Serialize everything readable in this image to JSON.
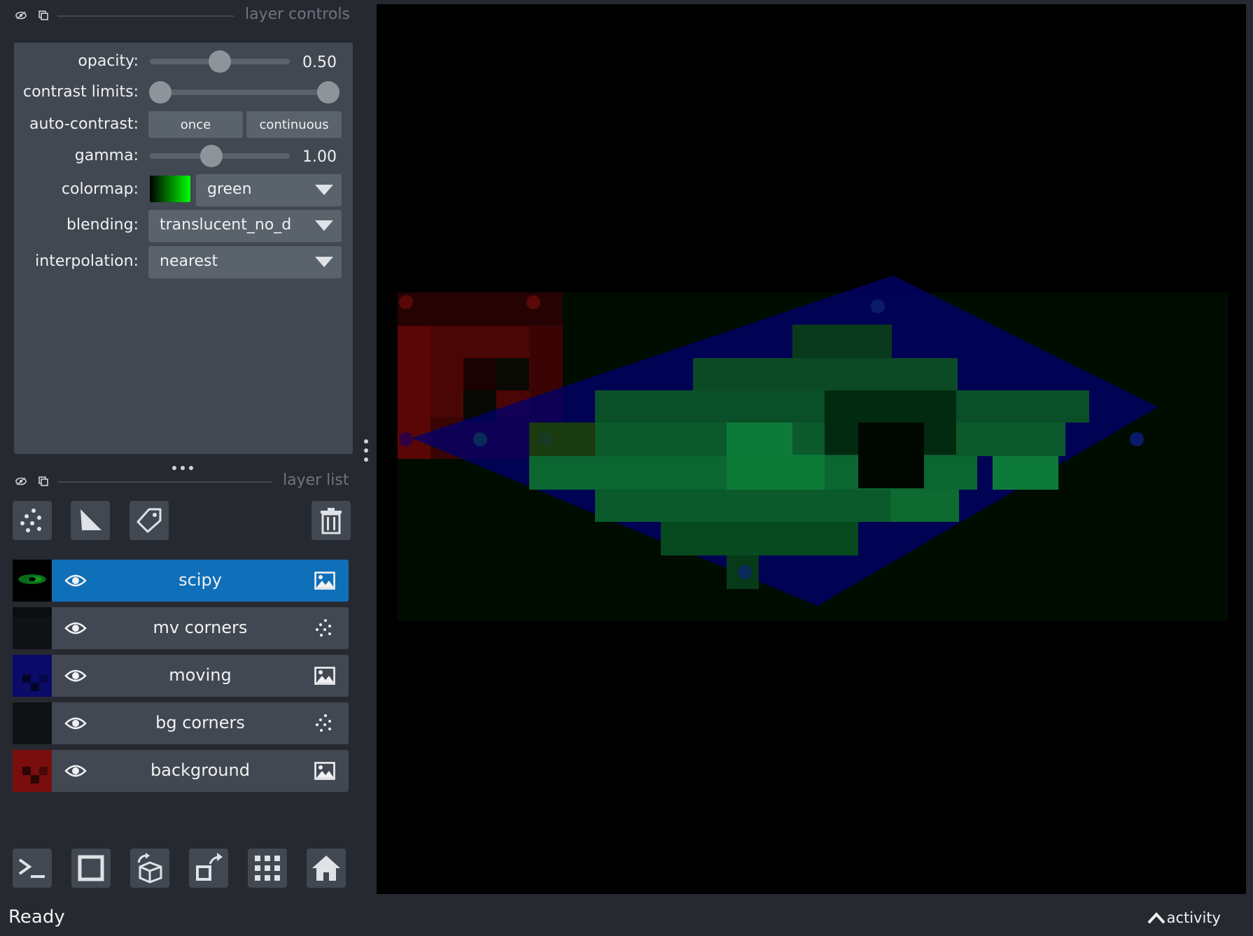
{
  "layer_controls": {
    "title": "layer controls",
    "opacity_label": "opacity:",
    "opacity_value": "0.50",
    "opacity_level": 0.5,
    "contrast_label": "contrast limits:",
    "contrast_range": [
      0.0,
      1.0
    ],
    "auto_contrast_label": "auto-contrast:",
    "once_label": "once",
    "continuous_label": "continuous",
    "gamma_label": "gamma:",
    "gamma_value": "1.00",
    "colormap_label": "colormap:",
    "colormap_value": "green",
    "blending_label": "blending:",
    "blending_value": "translucent_no_depth",
    "interpolation_label": "interpolation:",
    "interpolation_value": "nearest"
  },
  "layer_list": {
    "title": "layer list",
    "layers": [
      {
        "name": "scipy",
        "type": "image",
        "selected": true,
        "visible": true
      },
      {
        "name": "mv corners",
        "type": "points",
        "selected": false,
        "visible": true
      },
      {
        "name": "moving",
        "type": "image",
        "selected": false,
        "visible": true
      },
      {
        "name": "bg corners",
        "type": "points",
        "selected": false,
        "visible": true
      },
      {
        "name": "background",
        "type": "image",
        "selected": false,
        "visible": true
      }
    ]
  },
  "toolbar": {
    "new_points_icon": "points-icon",
    "new_shapes_icon": "shapes-icon",
    "new_labels_icon": "labels-tag-icon",
    "delete_icon": "trash-icon"
  },
  "bottom_bar": [
    "console-icon",
    "ndisplay-square-icon",
    "roll-cube-icon",
    "transpose-icon",
    "grid-icon",
    "home-icon"
  ],
  "status": {
    "text": "Ready",
    "activity_label": "activity"
  },
  "colors": {
    "selected_layer": "#0f6fb8",
    "panel_bg": "#262930",
    "widget_bg": "#414851"
  }
}
